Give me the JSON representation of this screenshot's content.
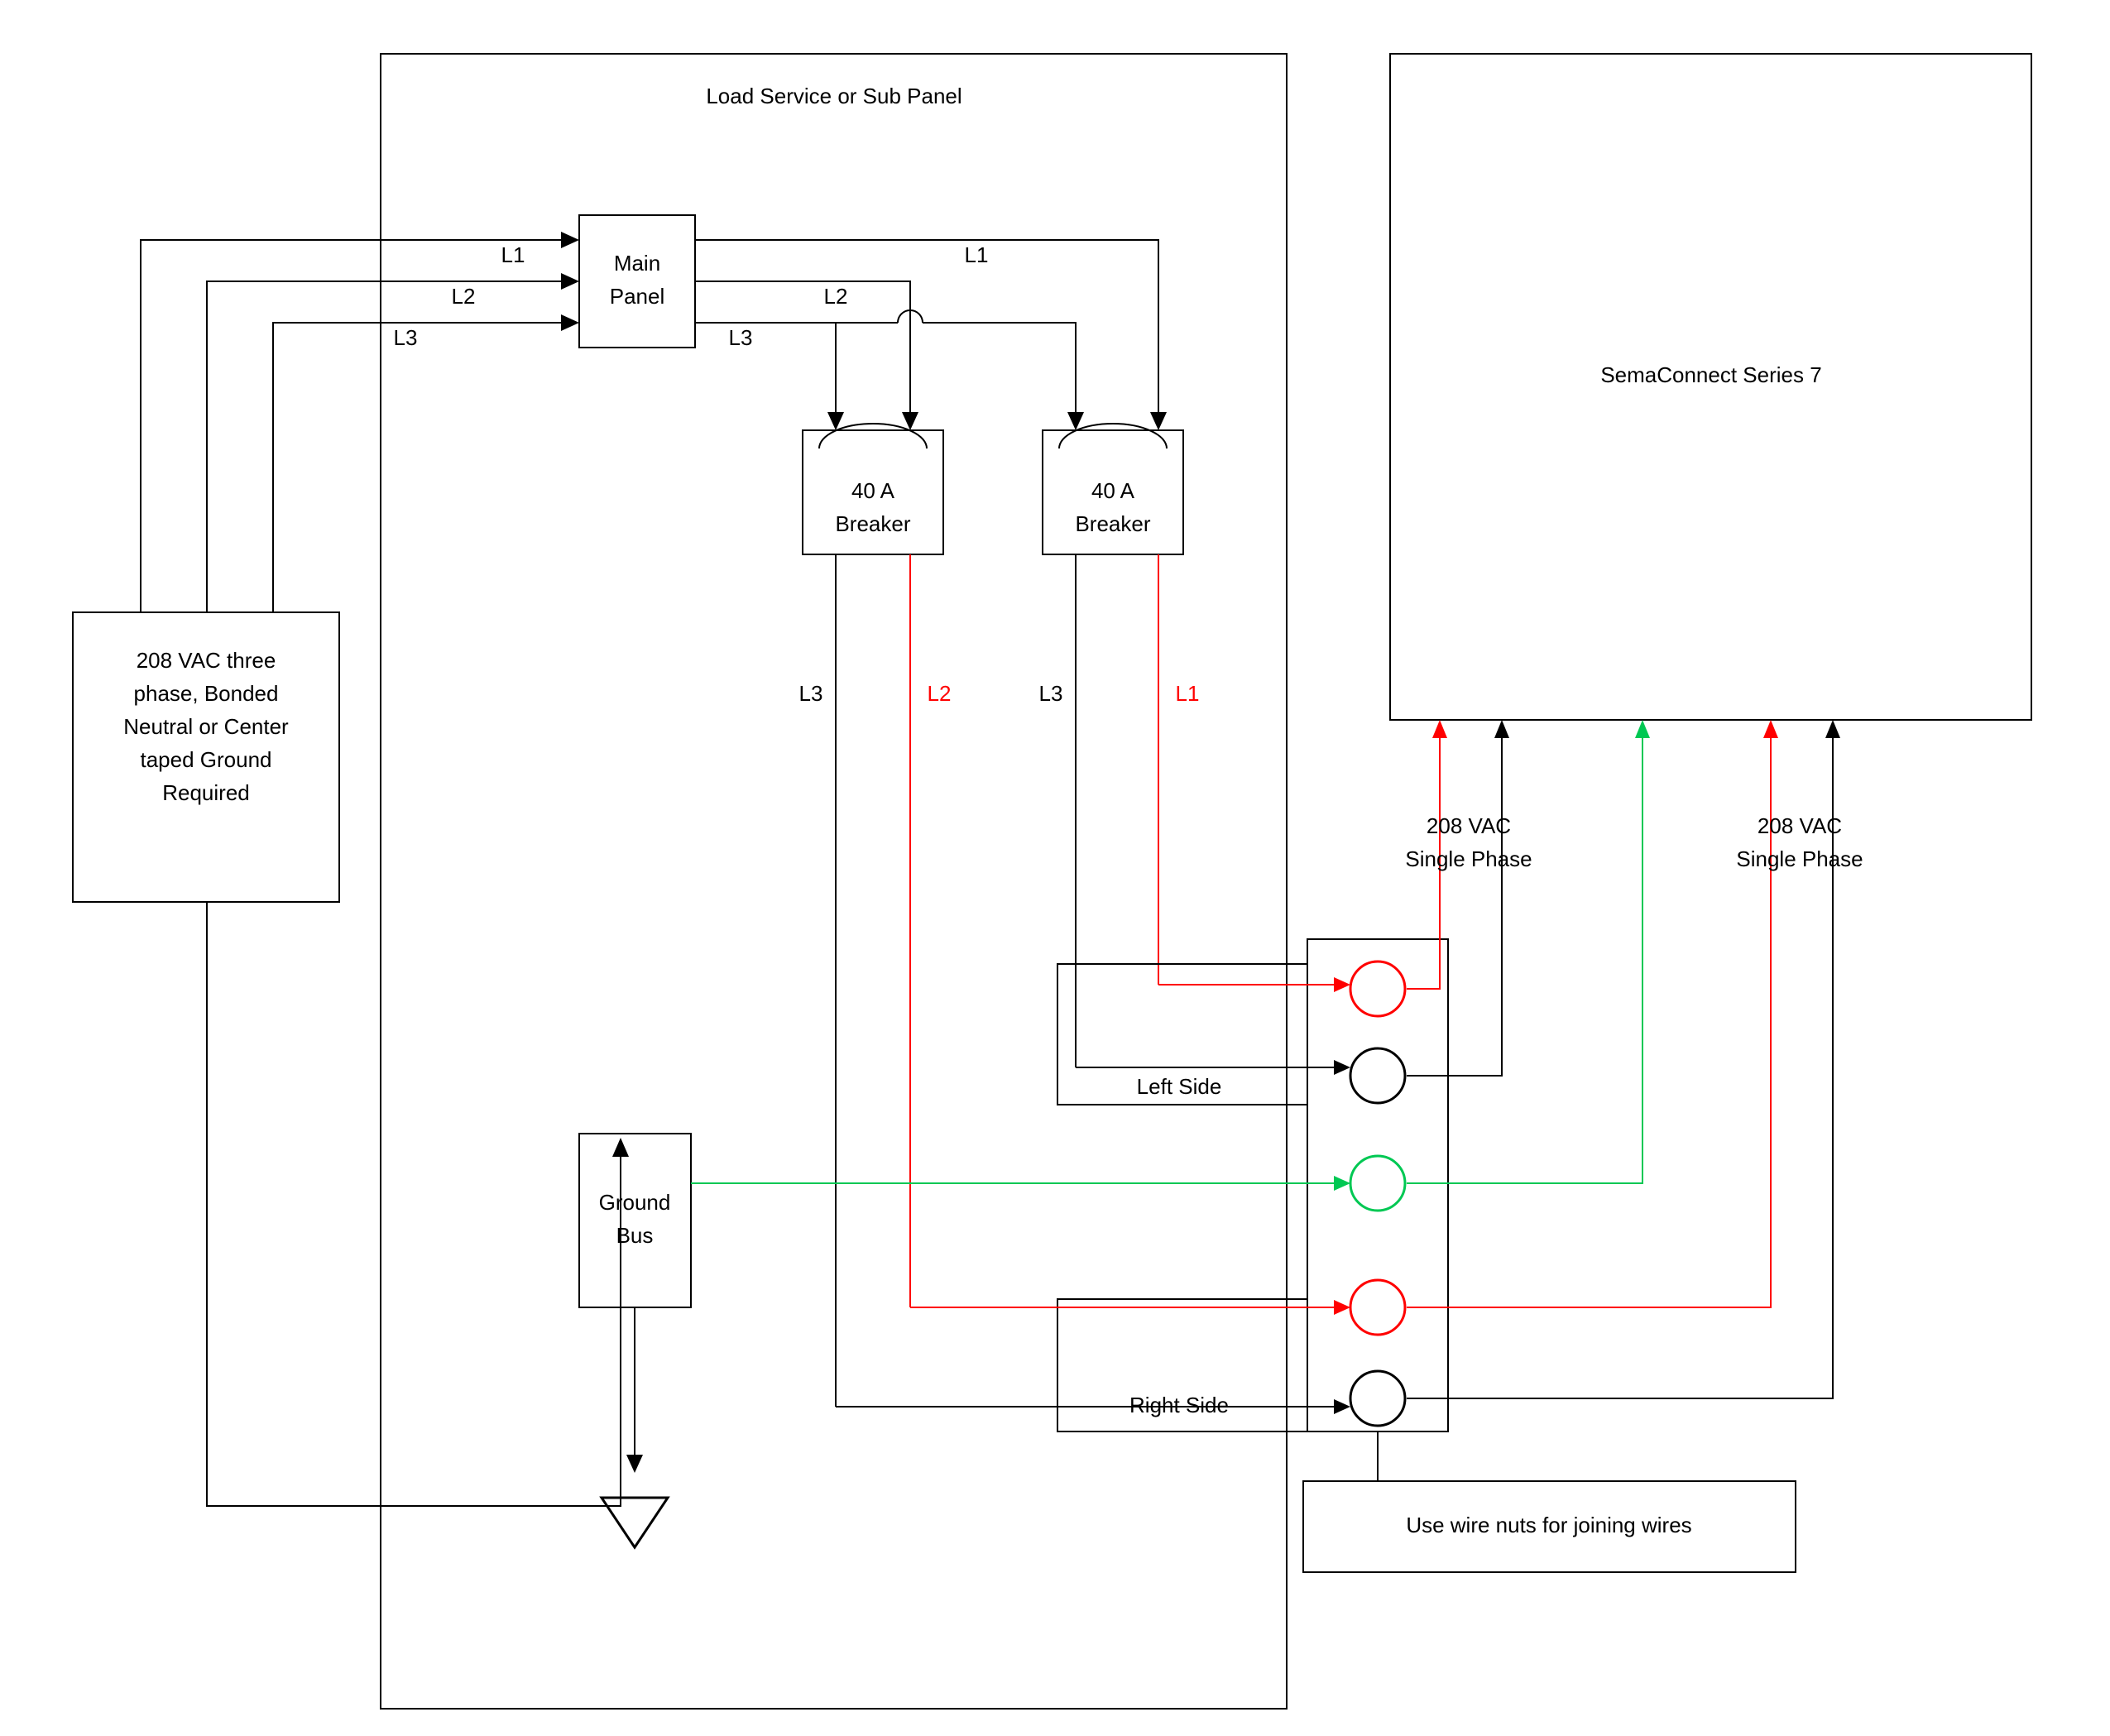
{
  "panel_title": "Load Service or Sub Panel",
  "supply_box": [
    "208 VAC three",
    "phase, Bonded",
    "Neutral or Center",
    "taped Ground",
    "Required"
  ],
  "main_panel": {
    "line1": "Main",
    "line2": "Panel"
  },
  "phases": {
    "l1": "L1",
    "l2": "L2",
    "l3": "L3"
  },
  "breaker": {
    "line1": "40 A",
    "line2": "Breaker"
  },
  "ground_bus": {
    "line1": "Ground",
    "line2": "Bus"
  },
  "sides": {
    "left": "Left Side",
    "right": "Right Side"
  },
  "device": "SemaConnect Series 7",
  "phase_label": {
    "line1": "208 VAC",
    "line2": "Single Phase"
  },
  "wire_nuts": "Use wire nuts for joining wires",
  "colors": {
    "black": "#000000",
    "red": "#ff0000",
    "green": "#00c853"
  }
}
